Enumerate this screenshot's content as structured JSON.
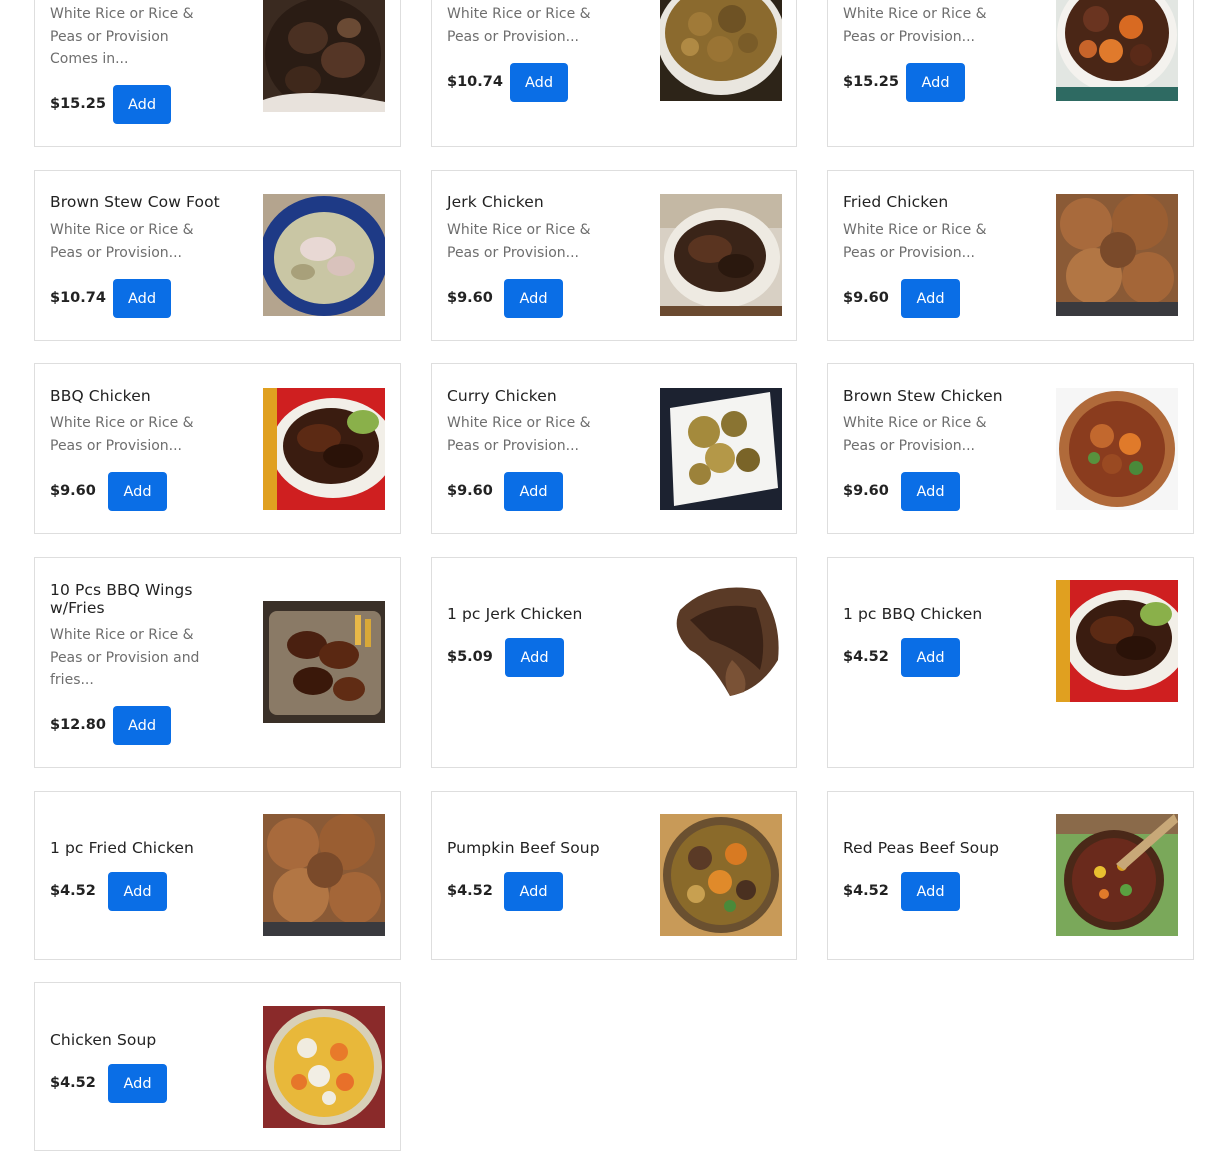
{
  "accent_color": "#0a6ee6",
  "items": [
    {
      "name": "",
      "desc": "White Rice or Rice & Peas or Provision Comes in...",
      "price": "$15.25",
      "add_label": "Add",
      "image": "stewed-oxtail-photo"
    },
    {
      "name": "",
      "desc": "White Rice or Rice & Peas or Provision...",
      "price": "$10.74",
      "add_label": "Add",
      "image": "curry-goat-photo"
    },
    {
      "name": "",
      "desc": "White Rice or Rice & Peas or Provision...",
      "price": "$15.25",
      "add_label": "Add",
      "image": "beef-stew-photo"
    },
    {
      "name": "Brown Stew Cow Foot",
      "desc": "White Rice or Rice & Peas or Provision...",
      "price": "$10.74",
      "add_label": "Add",
      "image": "cow-foot-bowl-photo"
    },
    {
      "name": "Jerk Chicken",
      "desc": "White Rice or Rice & Peas or Provision...",
      "price": "$9.60",
      "add_label": "Add",
      "image": "jerk-chicken-photo"
    },
    {
      "name": "Fried Chicken",
      "desc": "White Rice or Rice & Peas or Provision...",
      "price": "$9.60",
      "add_label": "Add",
      "image": "fried-chicken-photo"
    },
    {
      "name": "BBQ Chicken",
      "desc": "White Rice or Rice & Peas or Provision...",
      "price": "$9.60",
      "add_label": "Add",
      "image": "bbq-chicken-photo"
    },
    {
      "name": "Curry Chicken",
      "desc": "White Rice or Rice & Peas or Provision...",
      "price": "$9.60",
      "add_label": "Add",
      "image": "curry-chicken-photo"
    },
    {
      "name": "Brown Stew Chicken",
      "desc": "White Rice or Rice & Peas or Provision...",
      "price": "$9.60",
      "add_label": "Add",
      "image": "brown-stew-chicken-photo"
    },
    {
      "name": "10 Pcs BBQ Wings w/Fries",
      "desc": "White Rice or Rice & Peas or Provision and fries...",
      "price": "$12.80",
      "add_label": "Add",
      "image": "bbq-wings-photo"
    },
    {
      "name": "1 pc Jerk Chicken",
      "desc": "",
      "price": "$5.09",
      "add_label": "Add",
      "image": "jerk-chicken-leg-photo"
    },
    {
      "name": "1 pc BBQ Chicken",
      "desc": "",
      "price": "$4.52",
      "add_label": "Add",
      "image": "bbq-chicken-photo"
    },
    {
      "name": "1 pc Fried Chicken",
      "desc": "",
      "price": "$4.52",
      "add_label": "Add",
      "image": "fried-chicken-photo"
    },
    {
      "name": "Pumpkin Beef Soup",
      "desc": "",
      "price": "$4.52",
      "add_label": "Add",
      "image": "pumpkin-beef-soup-photo"
    },
    {
      "name": "Red Peas Beef Soup",
      "desc": "",
      "price": "$4.52",
      "add_label": "Add",
      "image": "red-peas-soup-photo"
    },
    {
      "name": "Chicken Soup",
      "desc": "",
      "price": "$4.52",
      "add_label": "Add",
      "image": "chicken-soup-photo"
    }
  ]
}
